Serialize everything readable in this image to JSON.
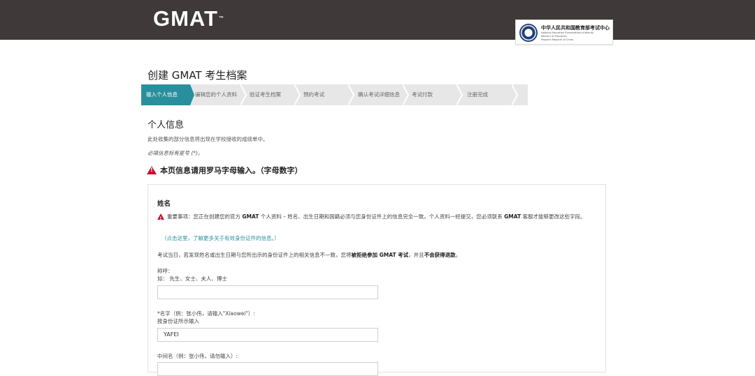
{
  "header": {
    "logo_text": "GMAT",
    "logo_tm": "™",
    "authority": {
      "cn_name": "中华人民共和国教育部考试中心",
      "en_lines": [
        "National Education Examinations Authority",
        "Ministry of Education",
        "People's Republic of China"
      ]
    },
    "colors": {
      "bar": "#3f3a39",
      "accent": "#2a8f9d",
      "warning": "#c8102e"
    }
  },
  "page_title": "创建 GMAT 考生档案",
  "steps": [
    {
      "label": "输入个人信息",
      "active": true
    },
    {
      "label": "编辑您的个人资料",
      "active": false
    },
    {
      "label": "验证考生档案",
      "active": false
    },
    {
      "label": "预约考试",
      "active": false
    },
    {
      "label": "确认考试详细信息",
      "active": false
    },
    {
      "label": "考试付款",
      "active": false
    },
    {
      "label": "注册完成",
      "active": false
    }
  ],
  "section": {
    "title": "个人信息",
    "intro": "此处收集的部分信息将出现在学校接收的成绩单中。",
    "required_note": "必填信息标有星号 (*)。",
    "roman_warning": "本页信息请用罗马字母输入。（字母数字）"
  },
  "name_box": {
    "title": "姓名",
    "notice_prefix": "重要事项：您正在创建您的官方 ",
    "notice_gmat1": "GMAT",
    "notice_mid": " 个人资料 – 姓名、出生日期和国籍必须与您身份证件上的信息完全一致。个人资料一经提交，您必须联系 ",
    "notice_gmat2": "GMAT",
    "notice_suffix": " 客服才能够更改这些字段。",
    "id_link": "（点击这里，了解更多关于有效身份证件的信息。）",
    "refusal_prefix": "考试当日，若发现姓名或出生日期与您所出示的身份证件上的相关信息不一致，您将",
    "refusal_bold1": "被拒绝参加 GMAT 考试",
    "refusal_mid": "，并且",
    "refusal_bold2": "不会获得退款",
    "refusal_end": "。",
    "salutation_label": "称呼：",
    "salutation_example": "如： 先生、女士、夫人、博士",
    "salutation_value": "",
    "first_name_label": "*名字（例：张小伟，请输入\"Xiaowei\"）:",
    "first_name_hint": "按身份证所示输入",
    "first_name_value": "YAFEI",
    "middle_name_label": "中间名（例：张小伟，请勿输入）:"
  }
}
